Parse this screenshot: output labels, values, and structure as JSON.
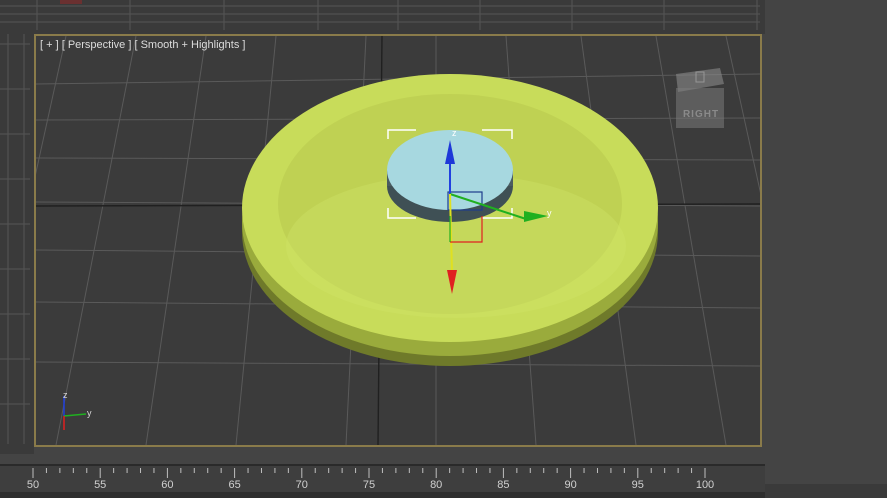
{
  "viewport": {
    "label": "[ + ] [ Perspective ] [ Smooth + Highlights ]",
    "viewcube_label": "RIGHT",
    "gizmo_axes": {
      "x": "x",
      "y": "y",
      "z": "z"
    },
    "axis_tripod": {
      "y": "y",
      "z": "z"
    }
  },
  "timeline": {
    "ticks": [
      "50",
      "55",
      "60",
      "65",
      "70",
      "75",
      "80",
      "85",
      "90",
      "95",
      "100"
    ]
  },
  "colors": {
    "viewport_bg": "#3b3b3b",
    "grid": "#5a5a5a",
    "active_border": "#8a7b4a",
    "disc": "#c8dc5a",
    "small_cylinder": "#a7d8e0",
    "axis_x": "#e02020",
    "axis_y": "#20b020",
    "axis_z": "#2040e0"
  }
}
